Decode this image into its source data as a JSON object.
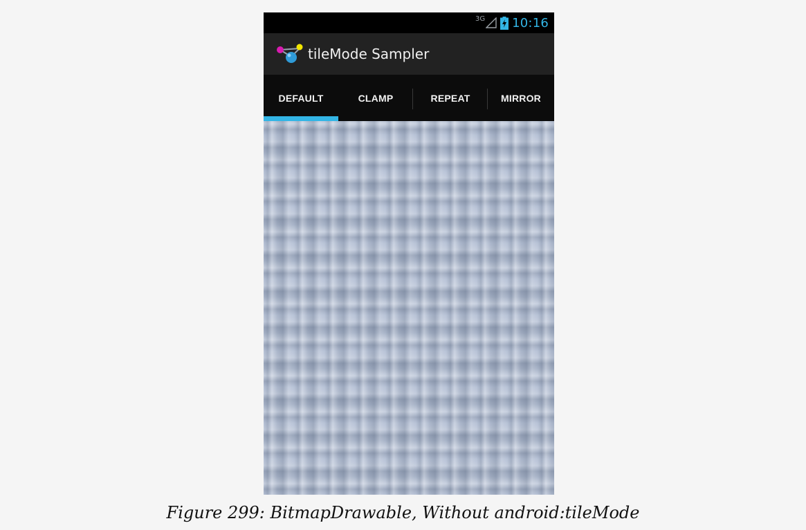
{
  "status_bar": {
    "network_type": "3G",
    "time": "10:16",
    "accent_color": "#33b5e5",
    "signal_icon": "signal-icon",
    "battery_icon": "battery-charging-icon"
  },
  "action_bar": {
    "app_icon": "app-icon",
    "title": "tileMode Sampler"
  },
  "tabs": [
    {
      "label": "DEFAULT",
      "selected": true
    },
    {
      "label": "CLAMP",
      "selected": false
    },
    {
      "label": "REPEAT",
      "selected": false
    },
    {
      "label": "MIRROR",
      "selected": false
    }
  ],
  "caption": "Figure 299: BitmapDrawable, Without android:tileMode"
}
